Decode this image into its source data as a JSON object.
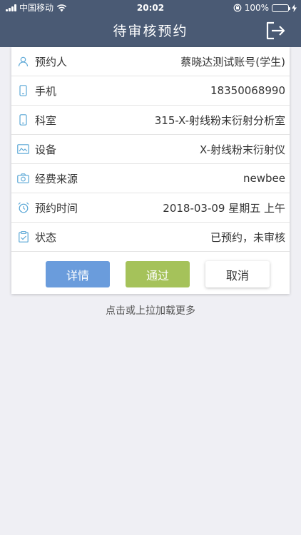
{
  "status_bar": {
    "carrier": "中国移动",
    "time": "20:02",
    "battery": "100%"
  },
  "nav": {
    "title": "待审核预约",
    "exit_icon": "logout-icon"
  },
  "card": {
    "rows": [
      {
        "icon": "person-icon",
        "label": "预约人",
        "value": "蔡晓达测试账号(学生)"
      },
      {
        "icon": "phone-icon",
        "label": "手机",
        "value": "18350068990"
      },
      {
        "icon": "phone-icon",
        "label": "科室",
        "value": "315-X-射线粉末衍射分析室"
      },
      {
        "icon": "monitor-icon",
        "label": "设备",
        "value": "X-射线粉末衍射仪"
      },
      {
        "icon": "camera-icon",
        "label": "经费来源",
        "value": "newbee"
      },
      {
        "icon": "alarm-clock-icon",
        "label": "预约时间",
        "value": "2018-03-09 星期五 上午"
      },
      {
        "icon": "clipboard-icon",
        "label": "状态",
        "value": "已预约，未审核"
      }
    ],
    "buttons": {
      "detail": "详情",
      "approve": "通过",
      "cancel": "取消"
    },
    "colors": {
      "detail": "#6a9cdc",
      "approve": "#a5c25a",
      "header": "#4a5a74"
    }
  },
  "load_more": "点击或上拉加载更多"
}
